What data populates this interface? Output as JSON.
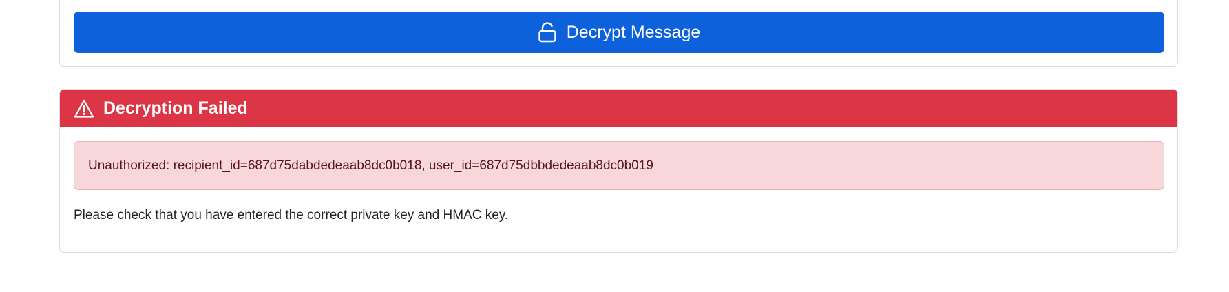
{
  "decrypt": {
    "button_label": "Decrypt Message",
    "button_color": "#0d62dc",
    "icon": "unlock-icon"
  },
  "error": {
    "title": "Decryption Failed",
    "header_color": "#dc3545",
    "icon": "warning-triangle-icon",
    "message": "Unauthorized: recipient_id=687d75dabdedeaab8dc0b018, user_id=687d75dbbdedeaab8dc0b019",
    "hint": "Please check that you have entered the correct private key and HMAC key."
  }
}
